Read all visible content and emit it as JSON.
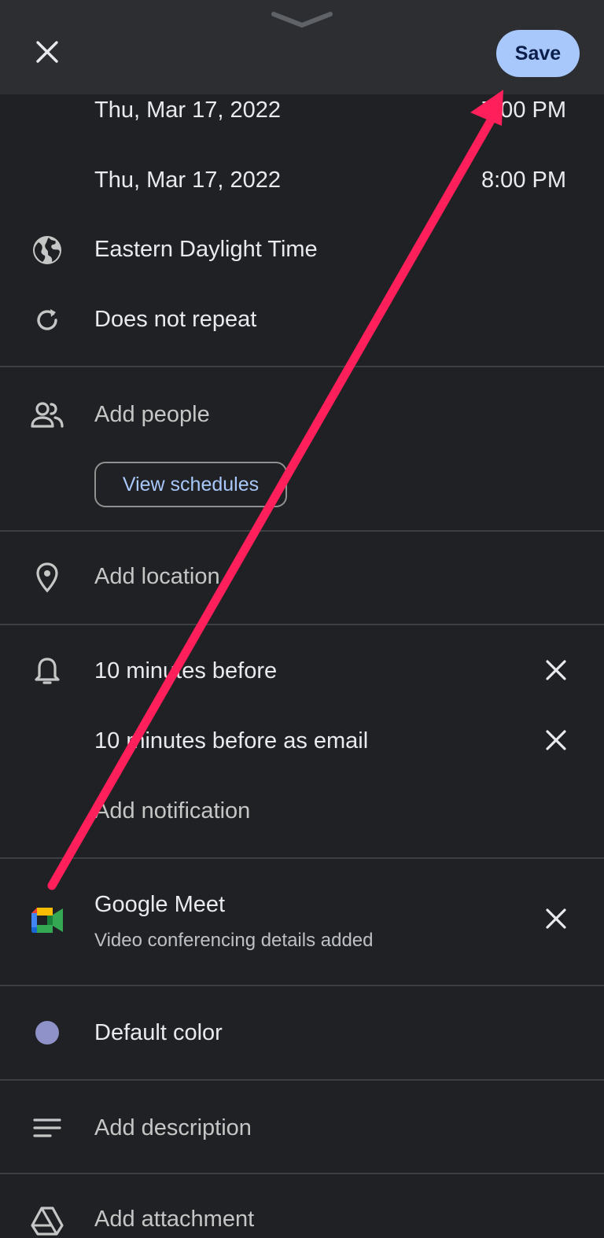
{
  "header": {
    "save_label": "Save"
  },
  "event": {
    "start_date": "Thu, Mar 17, 2022",
    "start_time": "7:00 PM",
    "end_date": "Thu, Mar 17, 2022",
    "end_time": "8:00 PM",
    "timezone": "Eastern Daylight Time",
    "repeat": "Does not repeat"
  },
  "people": {
    "add_label": "Add people",
    "view_schedules_label": "View schedules"
  },
  "location": {
    "add_label": "Add location"
  },
  "notifications": {
    "items": [
      {
        "label": "10 minutes before"
      },
      {
        "label": "10 minutes before as email"
      }
    ],
    "add_label": "Add notification"
  },
  "conferencing": {
    "title": "Google Meet",
    "subtitle": "Video conferencing details added"
  },
  "color": {
    "label": "Default color",
    "value": "#8e92c9"
  },
  "description": {
    "add_label": "Add description"
  },
  "attachment": {
    "add_label": "Add attachment"
  },
  "icons": {
    "close": "close-icon",
    "timezone": "globe-icon",
    "repeat": "repeat-icon",
    "people": "people-icon",
    "location": "location-pin-icon",
    "notification": "bell-icon",
    "meet": "google-meet-icon",
    "description": "notes-icon",
    "attachment": "drive-icon"
  },
  "colors": {
    "background": "#202124",
    "header": "#2d2e31",
    "save_button": "#a8c7fa",
    "annotation_arrow": "#ff1f5a"
  }
}
